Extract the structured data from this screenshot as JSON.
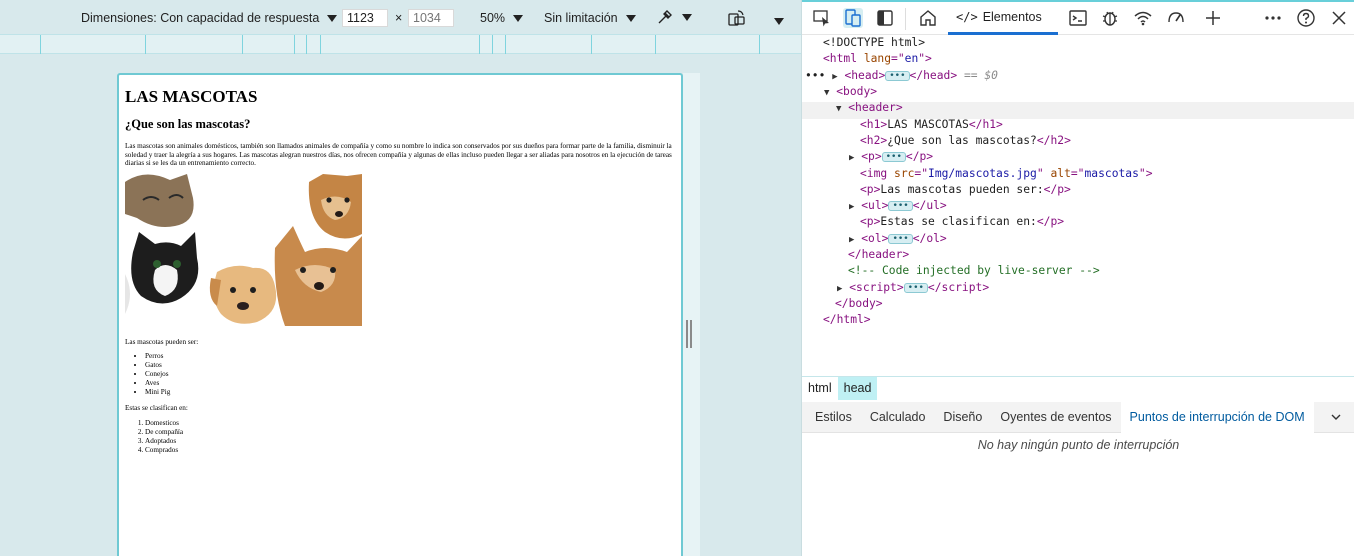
{
  "device_toolbar": {
    "dimensions_label": "Dimensiones: Con capacidad de respuesta",
    "width_value": "1123",
    "height_placeholder": "1034",
    "times": "×",
    "zoom_label": "50%",
    "throttle_label": "Sin limitación"
  },
  "preview": {
    "h1": "LAS MASCOTAS",
    "h2": "¿Que son las mascotas?",
    "intro": "Las mascotas son animales domésticos, también son llamados animales de compañía y como su nombre lo indica son conservados por sus dueños para formar parte de la familia, disminuir la soledad y traer la alegría a sus hogares. Las mascotas alegran nuestros días, nos ofrecen compañía y algunas de ellas incluso pueden llegar a ser aliadas para nosotros en la ejecución de tareas diarias si se les da un entrenamiento correcto.",
    "image_alt": "mascotas",
    "list_intro": "Las mascotas pueden ser:",
    "pets": [
      "Perros",
      "Gatos",
      "Conejos",
      "Aves",
      "Mini Pig"
    ],
    "class_intro": "Estas se clasifican en:",
    "classes": [
      "Domesticos",
      "De compañía",
      "Adoptados",
      "Comprados"
    ]
  },
  "devtools": {
    "elements_tab": "Elementos",
    "elements_icon": "</>",
    "dom": {
      "doctype": "<!DOCTYPE html>",
      "html_lang": "en",
      "head_suffix": "== $0",
      "h1_text": "LAS MASCOTAS",
      "h2_text": "¿Que son las mascotas?",
      "img_src": "Img/mascotas.jpg",
      "img_alt": "mascotas",
      "p2_text": "Las mascotas pueden ser:",
      "p3_text": "Estas se clasifican en:",
      "comment": "<!-- Code injected by live-server -->"
    },
    "breadcrumbs": [
      "html",
      "head"
    ],
    "subtabs": [
      "Estilos",
      "Calculado",
      "Diseño",
      "Oyentes de eventos",
      "Puntos de interrupción de DOM"
    ],
    "empty_message": "No hay ningún punto de interrupción"
  }
}
